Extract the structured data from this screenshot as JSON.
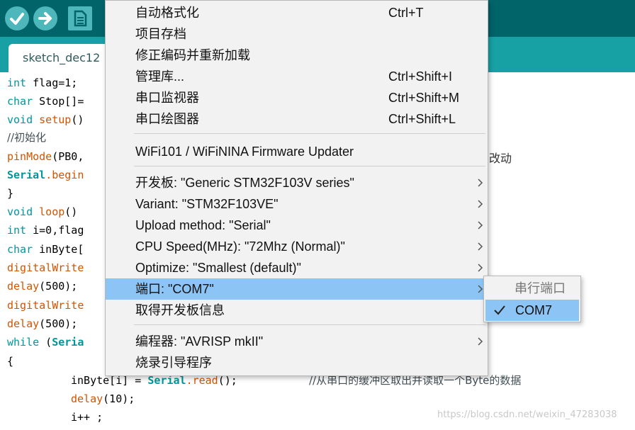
{
  "toolbar": {
    "buttons": [
      {
        "icon": "verify-check-icon"
      },
      {
        "icon": "upload-arrow-icon"
      },
      {
        "icon": "new-sketch-icon"
      }
    ]
  },
  "tab": {
    "label": "sketch_dec12"
  },
  "editor": {
    "lines": [
      {
        "kw": "int",
        "rest": " flag=1;"
      },
      {
        "kw": "char",
        "rest": " Stop[]="
      },
      {
        "kw": "void",
        "fn": " setup",
        "rest": "()"
      },
      {
        "comment": "//初始化"
      },
      {
        "fn": "pinMode",
        "rest": "(PB0,"
      },
      {
        "kwb": "Serial",
        "fn": ".begin",
        "rest": ""
      },
      {
        "rest": "}"
      },
      {
        "kw": "void",
        "fn": " loop",
        "rest": "()"
      },
      {
        "kw": "int",
        "rest": " i=0,flag"
      },
      {
        "kw": "char",
        "rest": " inByte["
      },
      {
        "fn": "digitalWrite",
        "rest": ""
      },
      {
        "fn": "delay",
        "rest": "(500);"
      },
      {
        "fn": "digitalWrite",
        "rest": ""
      },
      {
        "fn": "delay",
        "rest": "(500);"
      },
      {
        "kw": "while",
        "rest": " (",
        "kwb": "Seria"
      },
      {
        "rest": "{"
      }
    ],
    "fragment_right": "改动",
    "line_inbyte": {
      "pre": "inByte[i] = ",
      "kwb": "Serial",
      "fn": ".read",
      "post": "();",
      "comment": "//从串口的缓冲区取出并读取一个Byte的数据"
    },
    "line_delay": {
      "fn": "delay",
      "post": "(10);"
    },
    "line_inc": {
      "post": "i++ ;"
    },
    "watermark": "https://blog.csdn.net/weixin_47283038"
  },
  "menu": {
    "items": [
      {
        "label": "自动格式化",
        "shortcut": "Ctrl+T"
      },
      {
        "label": "项目存档",
        "shortcut": ""
      },
      {
        "label": "修正编码并重新加载",
        "shortcut": ""
      },
      {
        "label": "管理库...",
        "shortcut": "Ctrl+Shift+I"
      },
      {
        "label": "串口监视器",
        "shortcut": "Ctrl+Shift+M"
      },
      {
        "label": "串口绘图器",
        "shortcut": "Ctrl+Shift+L"
      },
      {
        "label": "WiFi101 / WiFiNINA Firmware Updater",
        "shortcut": ""
      },
      {
        "label": "开发板: \"Generic STM32F103V series\"",
        "submenu": true
      },
      {
        "label": "Variant: \"STM32F103VE\"",
        "submenu": true
      },
      {
        "label": "Upload method: \"Serial\"",
        "submenu": true
      },
      {
        "label": "CPU Speed(MHz): \"72Mhz (Normal)\"",
        "submenu": true
      },
      {
        "label": "Optimize: \"Smallest (default)\"",
        "submenu": true
      },
      {
        "label": "端口: \"COM7\"",
        "submenu": true,
        "selected": true
      },
      {
        "label": "取得开发板信息"
      },
      {
        "label": "编程器: \"AVRISP mkII\"",
        "submenu": true
      },
      {
        "label": "烧录引导程序"
      }
    ]
  },
  "submenu": {
    "header": "串行端口",
    "items": [
      {
        "label": "COM7",
        "checked": true
      }
    ]
  },
  "colors": {
    "toolbar": "#006468",
    "tabbar": "#17a1a5",
    "highlight": "#8cc4f5",
    "keyword": "#00979c",
    "function": "#d35400"
  }
}
